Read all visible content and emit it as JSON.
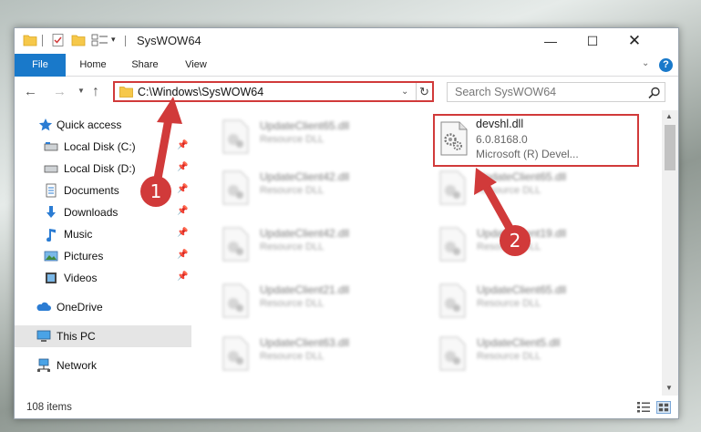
{
  "window": {
    "title": "SysWOW64",
    "controls": {
      "minimize": "—",
      "maximize": "☐",
      "close": "✕"
    }
  },
  "quick_access_toolbar": {
    "dropdown": "▾"
  },
  "ribbon": {
    "tabs": [
      "File",
      "Home",
      "Share",
      "View"
    ],
    "expand": "⌄",
    "help": "?",
    "accent": "#1979ca"
  },
  "navigation": {
    "back": "←",
    "forward": "→",
    "recent": "▼",
    "up": "↑"
  },
  "address_bar": {
    "path": "C:\\Windows\\SysWOW64",
    "dropdown": "⌄",
    "refresh": "↻"
  },
  "search": {
    "placeholder": "Search SysWOW64",
    "icon": "search-icon"
  },
  "nav_pane": {
    "items": [
      {
        "label": "Quick access",
        "icon": "star-icon",
        "pinned": false
      },
      {
        "label": "Local Disk (C:)",
        "icon": "drive-icon",
        "pinned": true
      },
      {
        "label": "Local Disk (D:)",
        "icon": "drive-icon",
        "pinned": true
      },
      {
        "label": "Documents",
        "icon": "documents-icon",
        "pinned": true
      },
      {
        "label": "Downloads",
        "icon": "downloads-icon",
        "pinned": true
      },
      {
        "label": "Music",
        "icon": "music-icon",
        "pinned": true
      },
      {
        "label": "Pictures",
        "icon": "pictures-icon",
        "pinned": true
      },
      {
        "label": "Videos",
        "icon": "videos-icon",
        "pinned": true
      },
      {
        "label": "OneDrive",
        "icon": "onedrive-icon",
        "pinned": false
      },
      {
        "label": "This PC",
        "icon": "computer-icon",
        "pinned": false,
        "selected": true
      },
      {
        "label": "Network",
        "icon": "network-icon",
        "pinned": false
      }
    ],
    "pin_glyph": "📌"
  },
  "files": {
    "left_column": [
      {
        "name": "UpdateClient65.dll",
        "desc": "Resource DLL"
      },
      {
        "name": "UpdateClient42.dll",
        "desc": "Resource DLL"
      },
      {
        "name": "UpdateClient42.dll",
        "desc": "Resource DLL"
      },
      {
        "name": "UpdateClient21.dll",
        "desc": "Resource DLL"
      },
      {
        "name": "UpdateClient63.dll",
        "desc": "Resource DLL"
      }
    ],
    "highlighted": {
      "name": "devshl.dll",
      "version": "6.0.8168.0",
      "company": "Microsoft (R) Devel..."
    },
    "right_column": [
      {
        "name": "UpdateClient65.dll",
        "desc": "Resource DLL"
      },
      {
        "name": "UpdateClient19.dll",
        "desc": "Resource DLL"
      },
      {
        "name": "UpdateClient65.dll",
        "desc": "Resource DLL"
      },
      {
        "name": "UpdateClient5.dll",
        "desc": "Resource DLL"
      }
    ]
  },
  "scrollbar": {
    "up": "▲",
    "down": "▼"
  },
  "status": {
    "item_count": "108 items"
  },
  "annotations": {
    "marker_1": "1",
    "marker_2": "2",
    "color": "#d13a3a"
  }
}
